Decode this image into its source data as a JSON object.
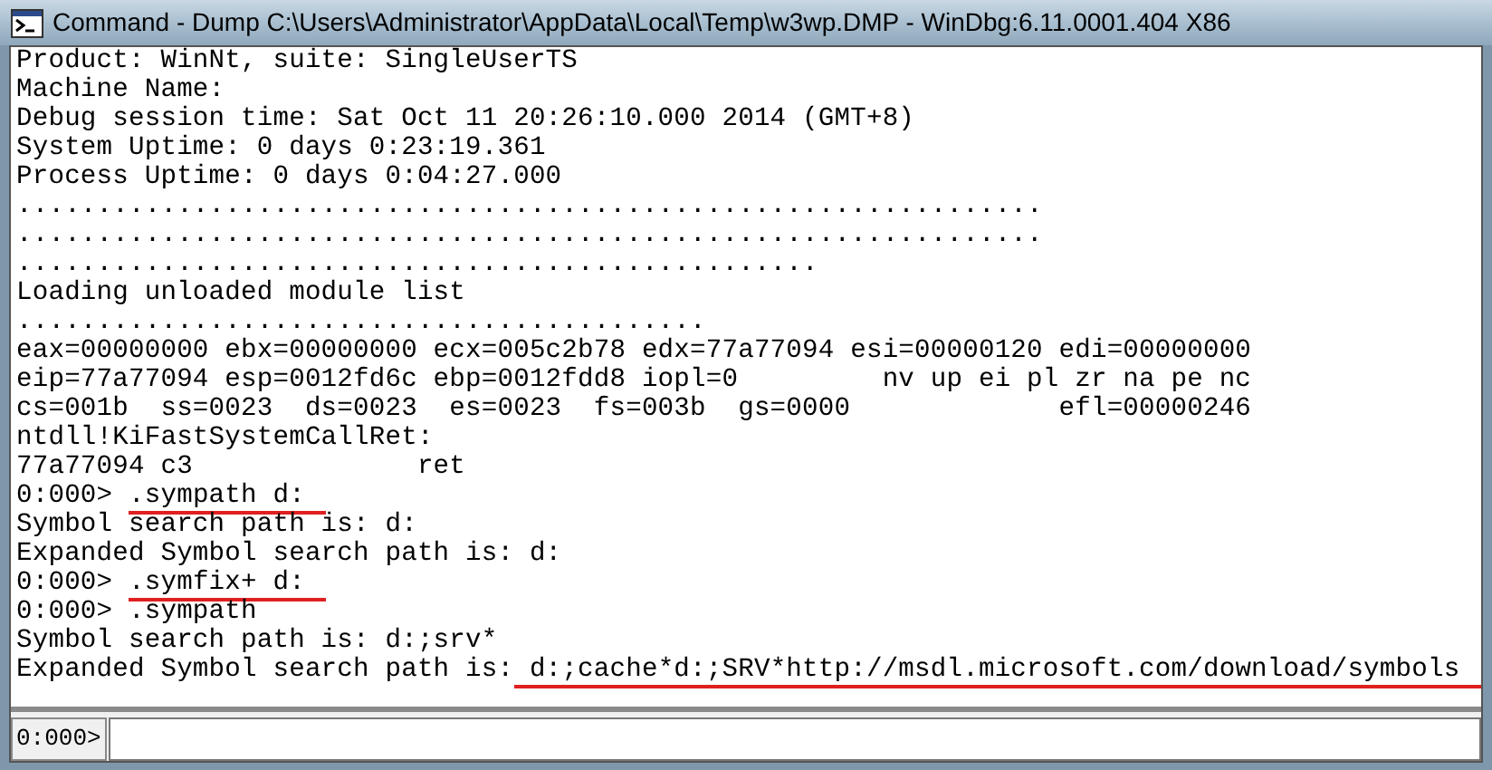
{
  "window": {
    "title": "Command - Dump C:\\Users\\Administrator\\AppData\\Local\\Temp\\w3wp.DMP - WinDbg:6.11.0001.404 X86"
  },
  "output": [
    {
      "segments": [
        {
          "text": "Product: WinNt, suite: SingleUserTS",
          "underlined": false
        }
      ]
    },
    {
      "segments": [
        {
          "text": "Machine Name:",
          "underlined": false
        }
      ]
    },
    {
      "segments": [
        {
          "text": "Debug session time: Sat Oct 11 20:26:10.000 2014 (GMT+8)",
          "underlined": false
        }
      ]
    },
    {
      "segments": [
        {
          "text": "System Uptime: 0 days 0:23:19.361",
          "underlined": false
        }
      ]
    },
    {
      "segments": [
        {
          "text": "Process Uptime: 0 days 0:04:27.000",
          "underlined": false
        }
      ]
    },
    {
      "segments": [
        {
          "text": "................................................................",
          "underlined": false
        }
      ]
    },
    {
      "segments": [
        {
          "text": "................................................................",
          "underlined": false
        }
      ]
    },
    {
      "segments": [
        {
          "text": "..................................................",
          "underlined": false
        }
      ]
    },
    {
      "segments": [
        {
          "text": "Loading unloaded module list",
          "underlined": false
        }
      ]
    },
    {
      "segments": [
        {
          "text": "...........................................",
          "underlined": false
        }
      ]
    },
    {
      "segments": [
        {
          "text": "eax=00000000 ebx=00000000 ecx=005c2b78 edx=77a77094 esi=00000120 edi=00000000",
          "underlined": false
        }
      ]
    },
    {
      "segments": [
        {
          "text": "eip=77a77094 esp=0012fd6c ebp=0012fdd8 iopl=0         nv up ei pl zr na pe nc",
          "underlined": false
        }
      ]
    },
    {
      "segments": [
        {
          "text": "cs=001b  ss=0023  ds=0023  es=0023  fs=003b  gs=0000             efl=00000246",
          "underlined": false
        }
      ]
    },
    {
      "segments": [
        {
          "text": "ntdll!KiFastSystemCallRet:",
          "underlined": false
        }
      ]
    },
    {
      "segments": [
        {
          "text": "77a77094 c3              ret",
          "underlined": false
        }
      ]
    },
    {
      "segments": [
        {
          "text": "0:000> ",
          "underlined": false
        },
        {
          "text": ".sympath d:",
          "underlined": true
        }
      ]
    },
    {
      "segments": [
        {
          "text": "Symbol search path is: d:",
          "underlined": false
        }
      ]
    },
    {
      "segments": [
        {
          "text": "Expanded Symbol search path is: d:",
          "underlined": false
        }
      ]
    },
    {
      "segments": [
        {
          "text": "0:000> ",
          "underlined": false
        },
        {
          "text": ".symfix+ d:",
          "underlined": true
        }
      ]
    },
    {
      "segments": [
        {
          "text": "0:000> .sympath",
          "underlined": false
        }
      ]
    },
    {
      "segments": [
        {
          "text": "Symbol search path is: d:;srv*",
          "underlined": false
        }
      ]
    },
    {
      "segments": [
        {
          "text": "Expanded Symbol search path is:",
          "underlined": false
        },
        {
          "text": " d:;cache*d:;SRV*http://msdl.microsoft.com/download/symbols",
          "underlined": true
        }
      ]
    }
  ],
  "command": {
    "prompt": "0:000>"
  }
}
